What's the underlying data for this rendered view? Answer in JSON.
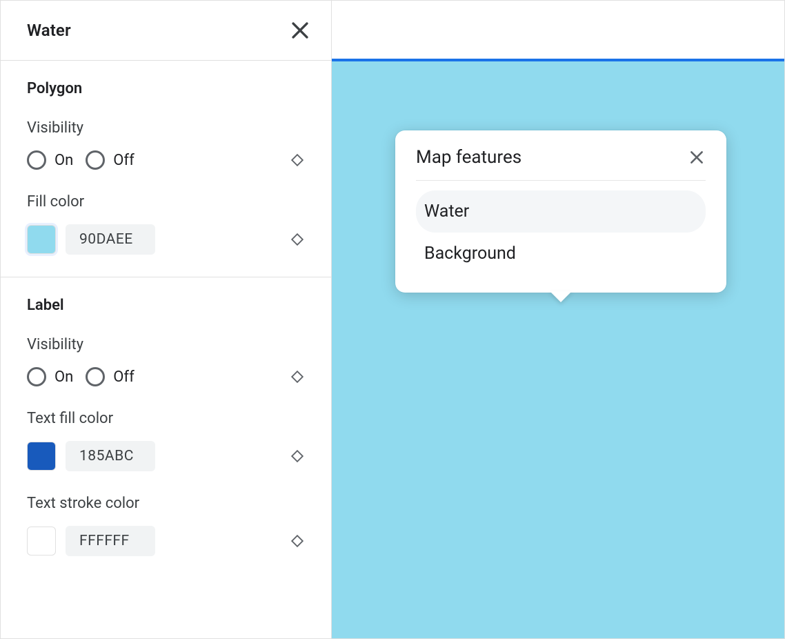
{
  "panel": {
    "title": "Water",
    "sections": {
      "polygon": {
        "title": "Polygon",
        "visibility_label": "Visibility",
        "on_label": "On",
        "off_label": "Off",
        "fill_color_label": "Fill color",
        "fill_color_hex": "90DAEE",
        "fill_color_swatch": "#90DAEE"
      },
      "label": {
        "title": "Label",
        "visibility_label": "Visibility",
        "on_label": "On",
        "off_label": "Off",
        "text_fill_label": "Text fill color",
        "text_fill_hex": "185ABC",
        "text_fill_swatch": "#185ABC",
        "text_stroke_label": "Text stroke color",
        "text_stroke_hex": "FFFFFF",
        "text_stroke_swatch": "#FFFFFF"
      }
    }
  },
  "map": {
    "water_color": "#90DAEE",
    "accent_bar_color": "#1a73e8"
  },
  "popover": {
    "title": "Map features",
    "items": [
      {
        "label": "Water",
        "selected": true
      },
      {
        "label": "Background",
        "selected": false
      }
    ]
  }
}
